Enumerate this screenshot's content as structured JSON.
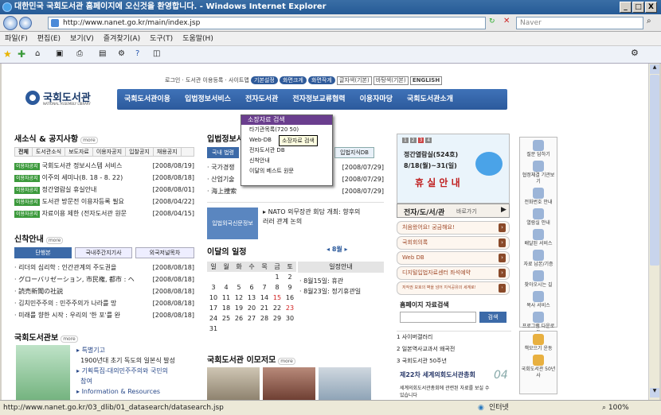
{
  "window": {
    "title": "대한민국 국회도서관 홈페이지에 오신것을 환영합니다. - Windows Internet Explorer",
    "min": "_",
    "max": "□",
    "close": "X"
  },
  "address": {
    "url": "http://www.nanet.go.kr/main/index.jsp",
    "search_placeholder": "Naver"
  },
  "menu": [
    "파일(F)",
    "편집(E)",
    "보기(V)",
    "즐겨찾기(A)",
    "도구(T)",
    "도움말(H)"
  ],
  "site": {
    "logo": "국회도서관",
    "logo_sub": "NATIONAL ASSEMBLY LIBRARY",
    "top_links": [
      "로그인",
      "도서관 이용등록",
      "사이트맵"
    ],
    "top_buttons": [
      "기본설정",
      "화면크게",
      "화면작게"
    ],
    "font_select": "글자색(기본)",
    "bg_select": "바탕색(기본)",
    "lang": "ENGLISH",
    "gnb": [
      "국회도서관이용",
      "입법정보서비스",
      "전자도서관",
      "전자정보교류협력",
      "이용자마당",
      "국회도서관소개"
    ]
  },
  "popup": {
    "items": [
      "소장자료 검색",
      "타기관목록(720 50)",
      "Web-DB",
      "전자도서관 DB",
      "신착안내",
      "이달의 베스트 원문"
    ],
    "tooltip": "소장자료 검색"
  },
  "news": {
    "title": "새소식 & 공지사항",
    "more": "more",
    "tabs": [
      "전체",
      "도서관소식",
      "보도자료",
      "이용자공지",
      "입찰공지",
      "채용공지"
    ],
    "tag": "이용자공지",
    "items": [
      {
        "text": "국회도서관 정보시스템 서비스",
        "date": "[2008/08/19]"
      },
      {
        "text": "이주의 세미나(8. 18 - 8. 22)",
        "date": "[2008/08/18]"
      },
      {
        "text": "정간열람실 휴실안내",
        "date": "[2008/08/01]"
      },
      {
        "text": "도서관 방문전 이용자등록 필요",
        "date": "[2008/04/22]"
      },
      {
        "text": "자료이용 제한 (전자도서관 원문",
        "date": "[2008/04/15]"
      }
    ]
  },
  "legis": {
    "title": "입법정보서",
    "tab": "국내 법령",
    "tab2": "입법지식DB",
    "items": [
      {
        "text": "국가경쟁",
        "date": "[2008/07/29]"
      },
      {
        "text": "산업기술",
        "date": "[2008/07/29]"
      },
      {
        "text": "海上捜索",
        "date": "[2008/07/29]"
      }
    ],
    "foreign_label": "입법외국신문정보",
    "foreign_items": [
      "NATO 외무장관 회담 개최: 향후의",
      "러러 관계 논의"
    ]
  },
  "newbooks": {
    "title": "신착안내",
    "tabs": [
      "단행본",
      "국내주간지기사",
      "외국저널목차"
    ],
    "items": [
      {
        "text": "리더의 심리학 : 인간관계의 주도권을",
        "date": "[2008/08/18]"
      },
      {
        "text": "グローバリゼーション, 市民権, 都市 : ヘ",
        "date": "[2008/08/18]"
      },
      {
        "text": "読売新聞の社説",
        "date": "[2008/08/18]"
      },
      {
        "text": "김치민주주의 : 민주주의가 나라를 망",
        "date": "[2008/08/18]"
      },
      {
        "text": "미래를 향한 시작 : 우리의 '한 포'를 완",
        "date": "[2008/08/18]"
      }
    ]
  },
  "calendar": {
    "title": "이달의 일정",
    "month": "8월",
    "head": [
      "일",
      "월",
      "화",
      "수",
      "목",
      "금",
      "토"
    ],
    "schedule_title": "일정안내",
    "weeks": [
      [
        "",
        "",
        "",
        "",
        "",
        "1",
        "2"
      ],
      [
        "3",
        "4",
        "5",
        "6",
        "7",
        "8",
        "9"
      ],
      [
        "10",
        "11",
        "12",
        "13",
        "14",
        "15",
        "16"
      ],
      [
        "17",
        "18",
        "19",
        "20",
        "21",
        "22",
        "23"
      ],
      [
        "24",
        "25",
        "26",
        "27",
        "28",
        "29",
        "30"
      ],
      [
        "31",
        "",
        "",
        "",
        "",
        "",
        ""
      ]
    ],
    "events": [
      "8월15일: 휴관",
      "8월23일: 정기휴관일"
    ]
  },
  "magazine": {
    "title": "국회도서관보",
    "more": "more",
    "items": [
      "특별기고",
      "1900년대 초기 독도의 일본식 발성",
      "기획특집-대의민주주의와 국민의",
      "참여",
      "Information & Resources"
    ]
  },
  "photo": {
    "title": "국회도서관 이모저모"
  },
  "notice_box": {
    "nums": [
      "1",
      "2",
      "3",
      "4"
    ],
    "title": "정간열람실(524호)",
    "period": "8/18(월)~31(일)",
    "big": "휴 실 안 내"
  },
  "elib": {
    "label": "전자/도/서/관",
    "go": "바로가기",
    "buttons": [
      "처음왔어요! 궁금해요!",
      "국회회의록",
      "Web DB",
      "디지털입법자료센터 좌석예약",
      "저작권 보호의 벽을 넘어 지식공유의 세계로!"
    ]
  },
  "hp_search": {
    "title": "홈페이지 자료검색",
    "button": "검색"
  },
  "links": [
    "사이버갤러리",
    "일본역사교과서 왜곡전",
    "국회도서관 50주년"
  ],
  "conference": {
    "title": "제22차 세계의회도서관총회",
    "num": "04",
    "desc": "세계의회도서관총회에 관련된 자료를 보실 수",
    "desc2": "있습니다"
  },
  "rail": [
    "질문 답하기",
    "협정체결 기관보기",
    "전화번호 안내",
    "열람실 안내",
    "배달된 서비스",
    "자료 납본/기증",
    "찾아오시는 길",
    "복사 서비스",
    "프로그램 다운로드"
  ],
  "rail2": [
    "책모으기 운동",
    "국회도서관 50년사"
  ],
  "status": {
    "url": "http://www.nanet.go.kr/03_dlib/01_datasearch/datasearch.jsp",
    "zone": "인터넷",
    "zoom": "100%"
  }
}
